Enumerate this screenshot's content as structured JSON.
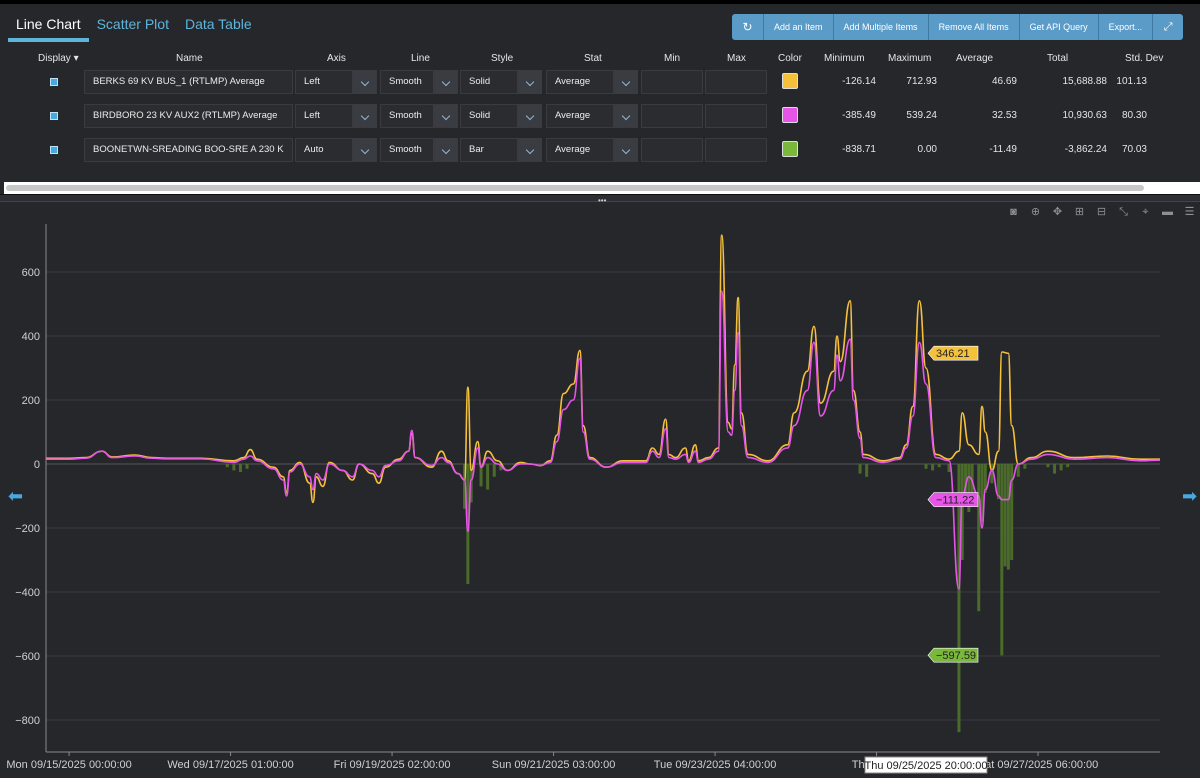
{
  "tabs": [
    "Line Chart",
    "Scatter Plot",
    "Data Table"
  ],
  "toolbar": {
    "refresh_icon": "↻",
    "add_item": "Add an Item",
    "add_multiple": "Add Multiple Items",
    "remove_all": "Remove All Items",
    "api_query": "Get API Query",
    "export": "Export...",
    "expand_icon": "⤢"
  },
  "columns": {
    "display": "Display",
    "name": "Name",
    "axis": "Axis",
    "line": "Line",
    "style": "Style",
    "stat": "Stat",
    "min": "Min",
    "max": "Max",
    "color": "Color",
    "minimum": "Minimum",
    "maximum": "Maximum",
    "average": "Average",
    "total": "Total",
    "std_dev": "Std. Dev"
  },
  "rows": [
    {
      "name": "BERKS 69 KV BUS_1 (RTLMP) Average",
      "axis": "Left",
      "line": "Smooth",
      "style": "Solid",
      "stat": "Average",
      "color": "#f5c03a",
      "minimum": "-126.14",
      "maximum": "712.93",
      "average": "46.69",
      "total": "15,688.88",
      "std_dev": "101.13"
    },
    {
      "name": "BIRDBORO 23 KV AUX2 (RTLMP) Average",
      "axis": "Left",
      "line": "Smooth",
      "style": "Solid",
      "stat": "Average",
      "color": "#e655e8",
      "minimum": "-385.49",
      "maximum": "539.24",
      "average": "32.53",
      "total": "10,930.63",
      "std_dev": "80.30"
    },
    {
      "name": "BOONETWN-SREADING BOO-SRE  A  230 K",
      "axis": "Auto",
      "line": "Smooth",
      "style": "Bar",
      "stat": "Average",
      "color": "#7ab83c",
      "minimum": "-838.71",
      "maximum": "0.00",
      "average": "-11.49",
      "total": "-3,862.24",
      "std_dev": "70.03"
    }
  ],
  "chart_data": {
    "type": "line",
    "ylim": [
      -900,
      750
    ],
    "yticks": [
      -800,
      -600,
      -400,
      -200,
      0,
      200,
      400,
      600
    ],
    "xticks": [
      "Mon 09/15/2025 00:00:00",
      "Wed 09/17/2025 01:00:00",
      "Fri 09/19/2025 02:00:00",
      "Sun 09/21/2025 03:00:00",
      "Tue 09/23/2025 04:00:00",
      "Thu 09/25",
      "Sat 09/27/2025 06:00:00"
    ],
    "xtick_hours": [
      0,
      49,
      98,
      147,
      196,
      245,
      294
    ],
    "x_hover_label": "Thu 09/25/2025 20:00:00",
    "hover_hour": 260,
    "x_range_hours": [
      -7,
      331
    ],
    "series": [
      {
        "name": "BERKS 69 KV BUS_1 (RTLMP) Average",
        "color": "#f5c03a",
        "points": [
          [
            -7,
            18
          ],
          [
            0,
            18
          ],
          [
            5,
            20
          ],
          [
            10,
            40
          ],
          [
            13,
            22
          ],
          [
            20,
            28
          ],
          [
            25,
            20
          ],
          [
            30,
            18
          ],
          [
            40,
            18
          ],
          [
            50,
            10
          ],
          [
            53,
            20
          ],
          [
            55,
            45
          ],
          [
            57,
            15
          ],
          [
            62,
            -10
          ],
          [
            65,
            -40
          ],
          [
            66,
            -90
          ],
          [
            67,
            -20
          ],
          [
            70,
            5
          ],
          [
            73,
            -60
          ],
          [
            74,
            -120
          ],
          [
            75,
            -40
          ],
          [
            77,
            -70
          ],
          [
            79,
            5
          ],
          [
            83,
            -20
          ],
          [
            86,
            -50
          ],
          [
            88,
            0
          ],
          [
            92,
            -30
          ],
          [
            94,
            -60
          ],
          [
            96,
            -10
          ],
          [
            100,
            15
          ],
          [
            103,
            40
          ],
          [
            104,
            95
          ],
          [
            105,
            20
          ],
          [
            110,
            -10
          ],
          [
            113,
            40
          ],
          [
            115,
            10
          ],
          [
            118,
            -30
          ],
          [
            120,
            -50
          ],
          [
            121,
            240
          ],
          [
            122,
            -20
          ],
          [
            124,
            70
          ],
          [
            125,
            -10
          ],
          [
            127,
            40
          ],
          [
            130,
            10
          ],
          [
            133,
            -20
          ],
          [
            137,
            5
          ],
          [
            140,
            0
          ],
          [
            143,
            -5
          ],
          [
            146,
            10
          ],
          [
            148,
            90
          ],
          [
            150,
            220
          ],
          [
            153,
            250
          ],
          [
            155,
            355
          ],
          [
            156,
            120
          ],
          [
            158,
            20
          ],
          [
            163,
            -10
          ],
          [
            168,
            10
          ],
          [
            175,
            10
          ],
          [
            177,
            50
          ],
          [
            179,
            30
          ],
          [
            181,
            140
          ],
          [
            182,
            30
          ],
          [
            184,
            20
          ],
          [
            187,
            50
          ],
          [
            188,
            10
          ],
          [
            190,
            60
          ],
          [
            191,
            10
          ],
          [
            194,
            20
          ],
          [
            197,
            50
          ],
          [
            198,
            715
          ],
          [
            200,
            130
          ],
          [
            201,
            110
          ],
          [
            202,
            310
          ],
          [
            203,
            520
          ],
          [
            204,
            160
          ],
          [
            206,
            30
          ],
          [
            212,
            10
          ],
          [
            218,
            60
          ],
          [
            220,
            160
          ],
          [
            224,
            290
          ],
          [
            226,
            430
          ],
          [
            228,
            190
          ],
          [
            232,
            290
          ],
          [
            233,
            400
          ],
          [
            234,
            320
          ],
          [
            237,
            510
          ],
          [
            238,
            230
          ],
          [
            240,
            100
          ],
          [
            241,
            30
          ],
          [
            247,
            10
          ],
          [
            252,
            20
          ],
          [
            254,
            60
          ],
          [
            256,
            180
          ],
          [
            258,
            510
          ],
          [
            260,
            300
          ],
          [
            263,
            30
          ],
          [
            267,
            15
          ],
          [
            270,
            40
          ],
          [
            271,
            160
          ],
          [
            273,
            60
          ],
          [
            276,
            30
          ],
          [
            277,
            180
          ],
          [
            278,
            100
          ],
          [
            280,
            -20
          ],
          [
            282,
            40
          ],
          [
            283,
            350
          ],
          [
            285,
            346
          ],
          [
            286,
            120
          ],
          [
            288,
            0
          ],
          [
            292,
            20
          ],
          [
            297,
            40
          ],
          [
            305,
            20
          ],
          [
            315,
            25
          ],
          [
            325,
            15
          ],
          [
            331,
            15
          ]
        ]
      },
      {
        "name": "BIRDBORO 23 KV AUX2 (RTLMP) Average",
        "color": "#e655e8",
        "points": [
          [
            -7,
            15
          ],
          [
            0,
            15
          ],
          [
            5,
            18
          ],
          [
            10,
            40
          ],
          [
            13,
            20
          ],
          [
            20,
            25
          ],
          [
            25,
            18
          ],
          [
            30,
            16
          ],
          [
            40,
            16
          ],
          [
            50,
            5
          ],
          [
            53,
            15
          ],
          [
            55,
            25
          ],
          [
            57,
            10
          ],
          [
            62,
            -15
          ],
          [
            65,
            -50
          ],
          [
            66,
            -100
          ],
          [
            67,
            -25
          ],
          [
            70,
            0
          ],
          [
            73,
            -40
          ],
          [
            74,
            -80
          ],
          [
            75,
            -30
          ],
          [
            77,
            -50
          ],
          [
            79,
            0
          ],
          [
            83,
            -20
          ],
          [
            86,
            -40
          ],
          [
            88,
            0
          ],
          [
            92,
            -20
          ],
          [
            94,
            -40
          ],
          [
            96,
            -5
          ],
          [
            100,
            10
          ],
          [
            103,
            40
          ],
          [
            104,
            105
          ],
          [
            105,
            20
          ],
          [
            110,
            -5
          ],
          [
            113,
            20
          ],
          [
            115,
            5
          ],
          [
            118,
            -30
          ],
          [
            120,
            -50
          ],
          [
            121,
            -210
          ],
          [
            122,
            -50
          ],
          [
            124,
            50
          ],
          [
            125,
            -10
          ],
          [
            127,
            20
          ],
          [
            130,
            0
          ],
          [
            133,
            -20
          ],
          [
            137,
            0
          ],
          [
            140,
            0
          ],
          [
            143,
            -5
          ],
          [
            146,
            5
          ],
          [
            148,
            70
          ],
          [
            150,
            170
          ],
          [
            153,
            200
          ],
          [
            155,
            330
          ],
          [
            156,
            100
          ],
          [
            158,
            15
          ],
          [
            163,
            -10
          ],
          [
            168,
            5
          ],
          [
            175,
            5
          ],
          [
            177,
            40
          ],
          [
            179,
            20
          ],
          [
            181,
            110
          ],
          [
            182,
            20
          ],
          [
            184,
            15
          ],
          [
            187,
            30
          ],
          [
            188,
            5
          ],
          [
            190,
            40
          ],
          [
            191,
            5
          ],
          [
            194,
            15
          ],
          [
            197,
            40
          ],
          [
            198,
            540
          ],
          [
            200,
            100
          ],
          [
            201,
            90
          ],
          [
            202,
            230
          ],
          [
            203,
            410
          ],
          [
            204,
            120
          ],
          [
            206,
            20
          ],
          [
            212,
            5
          ],
          [
            218,
            50
          ],
          [
            220,
            120
          ],
          [
            224,
            230
          ],
          [
            226,
            380
          ],
          [
            228,
            150
          ],
          [
            232,
            230
          ],
          [
            233,
            340
          ],
          [
            234,
            260
          ],
          [
            237,
            390
          ],
          [
            238,
            200
          ],
          [
            240,
            80
          ],
          [
            241,
            20
          ],
          [
            247,
            5
          ],
          [
            252,
            15
          ],
          [
            254,
            50
          ],
          [
            256,
            150
          ],
          [
            258,
            380
          ],
          [
            260,
            250
          ],
          [
            263,
            20
          ],
          [
            267,
            10
          ],
          [
            270,
            -390
          ],
          [
            271,
            -100
          ],
          [
            273,
            -40
          ],
          [
            276,
            -100
          ],
          [
            277,
            -200
          ],
          [
            278,
            -80
          ],
          [
            280,
            -20
          ],
          [
            282,
            -100
          ],
          [
            283,
            -111
          ],
          [
            285,
            -111
          ],
          [
            286,
            -50
          ],
          [
            288,
            0
          ],
          [
            292,
            15
          ],
          [
            297,
            30
          ],
          [
            305,
            15
          ],
          [
            315,
            20
          ],
          [
            325,
            10
          ],
          [
            331,
            12
          ]
        ]
      },
      {
        "name": "BOONETWN-SREADING BOO-SRE  A  230 K",
        "color": "#4a6b2a",
        "bars": [
          [
            48,
            -10
          ],
          [
            50,
            -20
          ],
          [
            52,
            -25
          ],
          [
            54,
            -15
          ],
          [
            120,
            -140
          ],
          [
            121,
            -375
          ],
          [
            122,
            -120
          ],
          [
            125,
            -70
          ],
          [
            127,
            -80
          ],
          [
            129,
            -40
          ],
          [
            131,
            -20
          ],
          [
            240,
            -30
          ],
          [
            242,
            -40
          ],
          [
            260,
            -15
          ],
          [
            262,
            -20
          ],
          [
            264,
            -10
          ],
          [
            267,
            -25
          ],
          [
            270,
            -838
          ],
          [
            271,
            -300
          ],
          [
            272,
            -120
          ],
          [
            273,
            -150
          ],
          [
            274,
            -110
          ],
          [
            276,
            -460
          ],
          [
            277,
            -180
          ],
          [
            278,
            -90
          ],
          [
            280,
            -60
          ],
          [
            282,
            -110
          ],
          [
            283,
            -598
          ],
          [
            284,
            -320
          ],
          [
            285,
            -330
          ],
          [
            286,
            -300
          ],
          [
            288,
            -40
          ],
          [
            290,
            -15
          ],
          [
            297,
            -10
          ],
          [
            299,
            -30
          ],
          [
            301,
            -20
          ],
          [
            303,
            -10
          ]
        ]
      }
    ],
    "hover_labels": [
      {
        "text": "346.21",
        "color": "#f5c03a",
        "value": 346.21
      },
      {
        "text": "−111.22",
        "color": "#e655e8",
        "value": -111.22
      },
      {
        "text": "−597.59",
        "color": "#7ab83c",
        "value": -597.59
      }
    ]
  }
}
